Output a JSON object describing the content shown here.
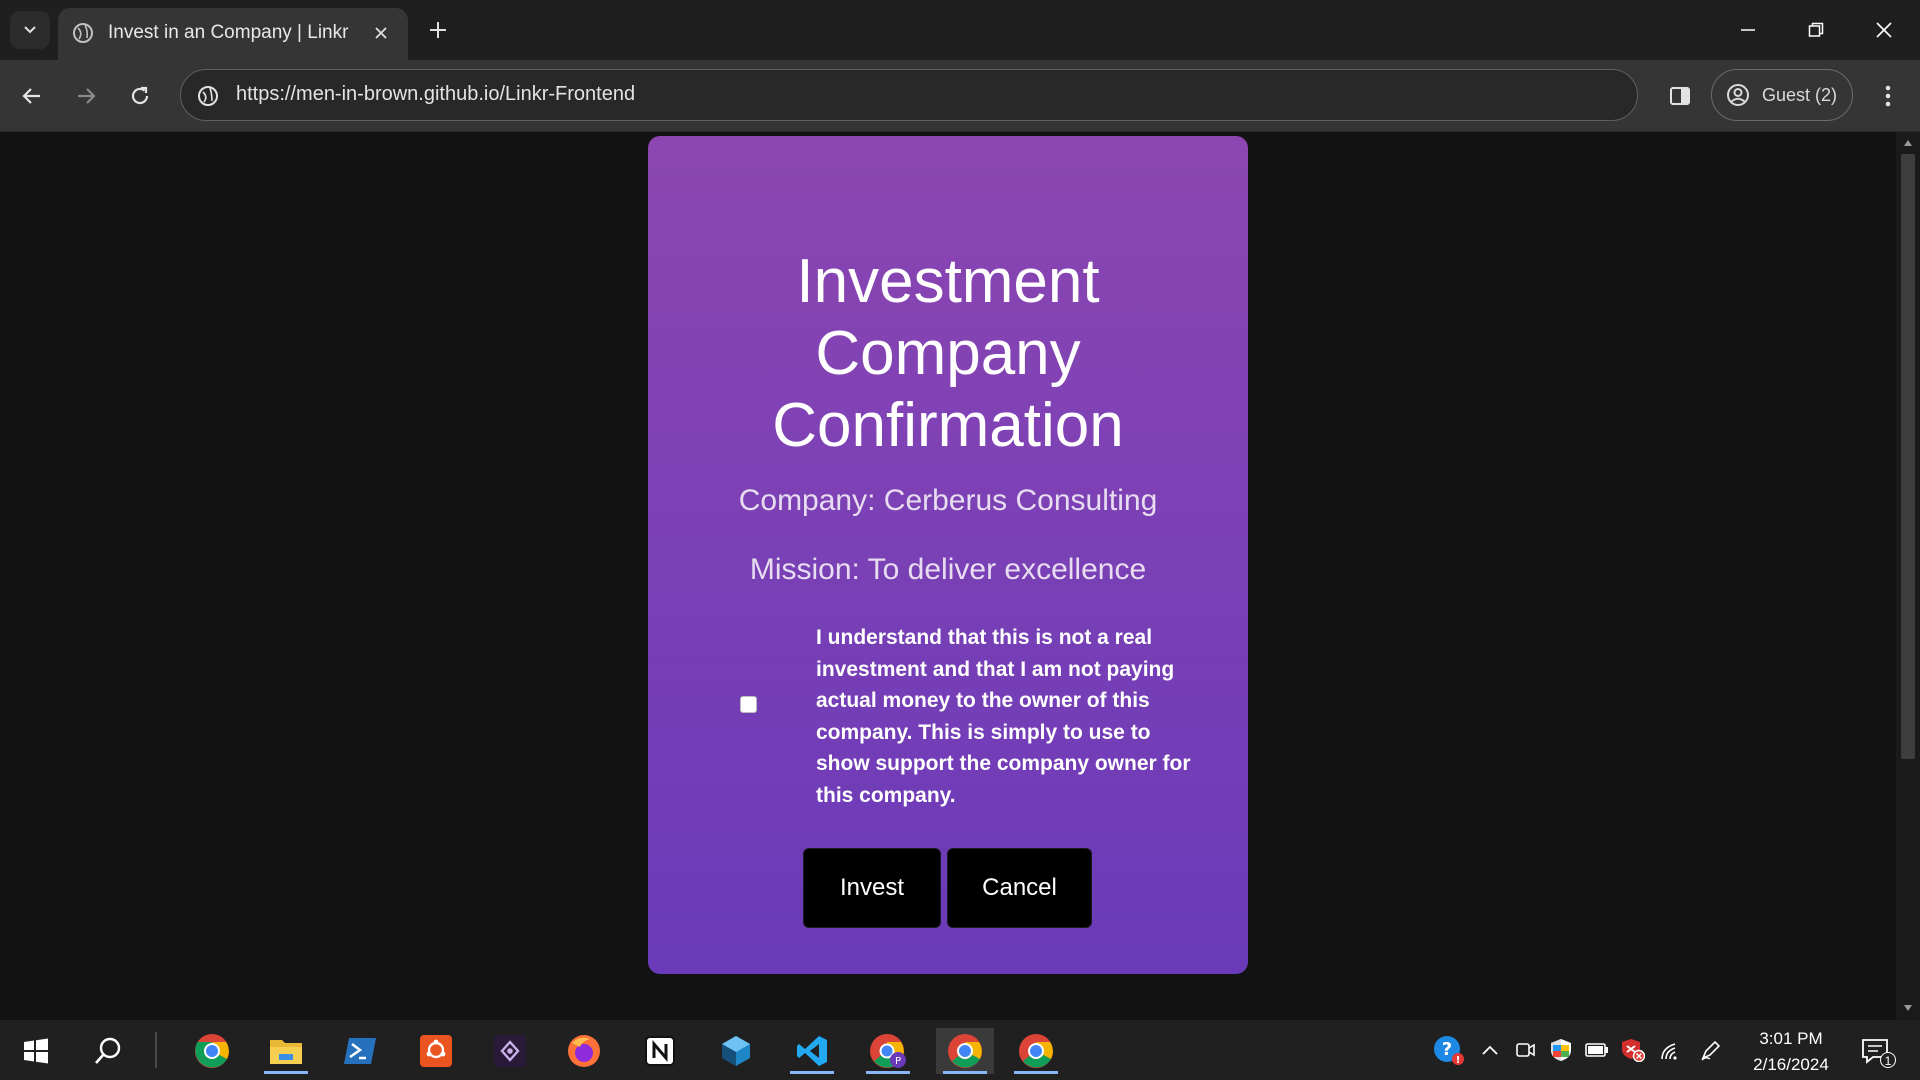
{
  "browser": {
    "tab": {
      "title": "Invest in an Company | Linkr"
    },
    "url": "https://men-in-brown.github.io/Linkr-Frontend",
    "profile_label": "Guest (2)"
  },
  "modal": {
    "title": "Investment Company Confirmation",
    "company": "Company: Cerberus Consulting",
    "mission": "Mission: To deliver excellence",
    "consent_text": "I understand that this is not a real investment and that I am not paying actual money to the owner of this company. This is simply to use to show support the company owner for this company.",
    "consent_checked": false,
    "invest_label": "Invest",
    "cancel_label": "Cancel"
  },
  "taskbar": {
    "apps": [
      "start-icon",
      "search-icon",
      "chrome-icon",
      "file-explorer-icon",
      "powershell-icon",
      "ubuntu-icon",
      "obs-icon",
      "firefox-icon",
      "notion-icon",
      "azure-data-studio-icon",
      "vscode-icon",
      "chrome-profile-icon",
      "chrome-icon",
      "chrome-icon"
    ],
    "clock_time": "3:01 PM",
    "clock_date": "2/16/2024",
    "notification_count": "1"
  },
  "colors": {
    "card_top": "#8c46b0",
    "card_bottom": "#6a3ab8",
    "button_bg": "#000000",
    "page_bg": "#121212"
  }
}
